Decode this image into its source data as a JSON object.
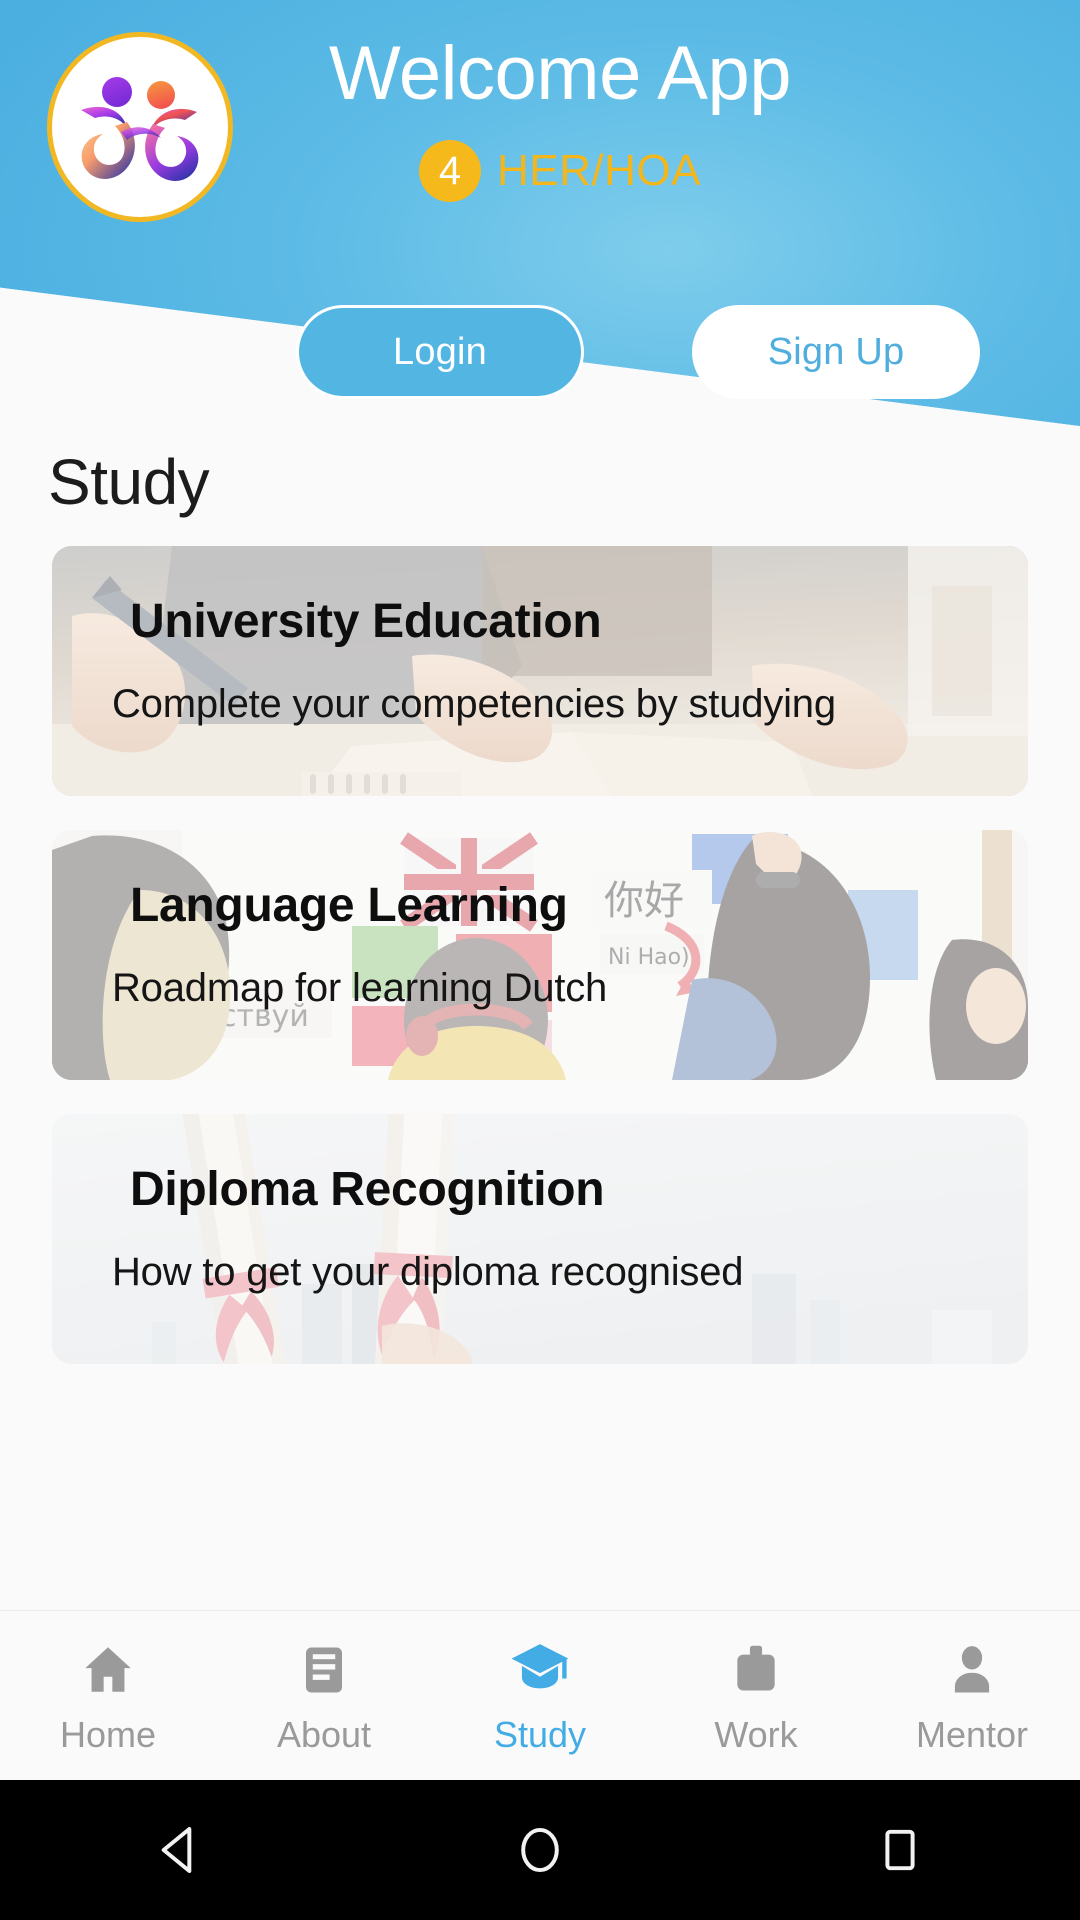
{
  "header": {
    "app_title": "Welcome App",
    "badge_count": "4",
    "badge_label": "HER/HOA",
    "login_label": "Login",
    "signup_label": "Sign Up",
    "colors": {
      "header_blue": "#4FB4E2",
      "badge_amber": "#F6B91C",
      "logo_ring": "#F2B824"
    }
  },
  "main": {
    "page_title": "Study",
    "cards": [
      {
        "title": "University Education",
        "subtitle": "Complete your competencies by studying",
        "image": "hands-writing-notes-photo"
      },
      {
        "title": "Language Learning",
        "subtitle": "Roadmap for learning Dutch",
        "image": "students-world-flags-wall-photo"
      },
      {
        "title": "Diploma Recognition",
        "subtitle": "How to get your diploma recognised",
        "image": "rolled-diplomas-red-ribbon-photo"
      }
    ]
  },
  "bottom_nav": {
    "active_color": "#43ACE4",
    "inactive_color": "#9A9A9A",
    "items": [
      {
        "label": "Home",
        "icon": "home-icon",
        "active": false
      },
      {
        "label": "About",
        "icon": "article-icon",
        "active": false
      },
      {
        "label": "Study",
        "icon": "graduation-cap-icon",
        "active": true
      },
      {
        "label": "Work",
        "icon": "briefcase-icon",
        "active": false
      },
      {
        "label": "Mentor",
        "icon": "person-icon",
        "active": false
      }
    ]
  },
  "system_bar": {
    "buttons": [
      {
        "name": "back-button",
        "icon": "triangle-left-icon"
      },
      {
        "name": "home-button",
        "icon": "circle-icon"
      },
      {
        "name": "recents-button",
        "icon": "square-icon"
      }
    ]
  }
}
